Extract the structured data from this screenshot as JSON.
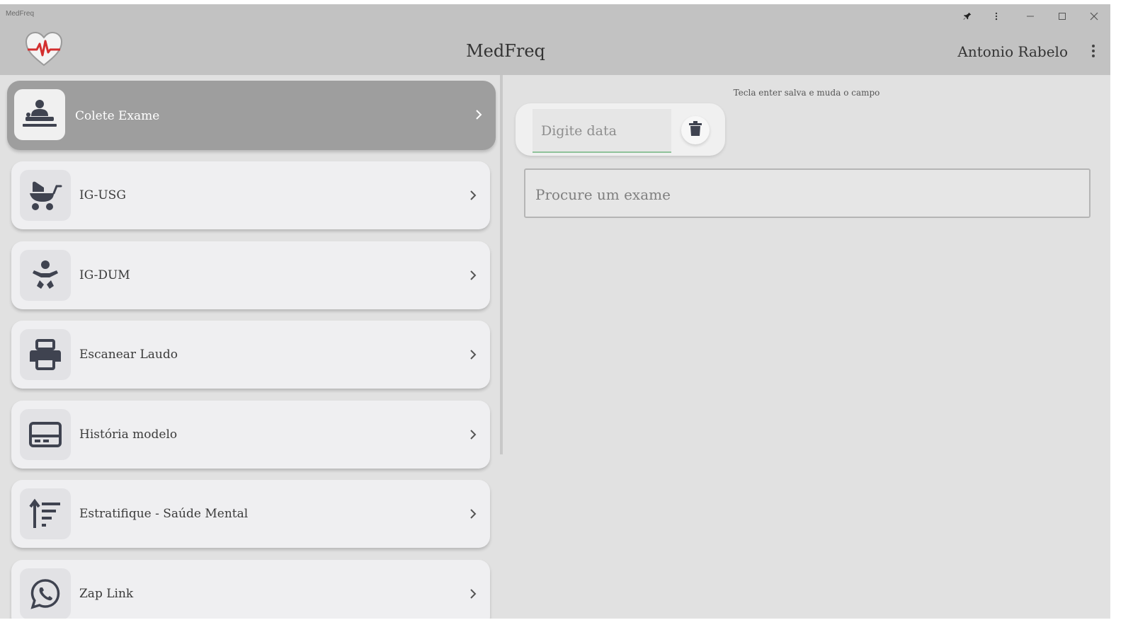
{
  "window": {
    "title": "MedFreq",
    "controls": [
      "pin-icon",
      "more-vert-icon",
      "minimize-icon",
      "maximize-icon",
      "close-icon"
    ]
  },
  "header": {
    "app_title": "MedFreq",
    "user_name": "Antonio Rabelo",
    "logo_icon": "heart-ecg-icon",
    "menu_icon": "more-vert-icon"
  },
  "sidebar": {
    "items": [
      {
        "label": "Colete Exame",
        "icon": "doctor-patient-icon",
        "active": true
      },
      {
        "label": "IG-USG",
        "icon": "baby-stroller-icon",
        "active": false
      },
      {
        "label": "IG-DUM",
        "icon": "baby-icon",
        "active": false
      },
      {
        "label": "Escanear Laudo",
        "icon": "printer-icon",
        "active": false
      },
      {
        "label": "História modelo",
        "icon": "card-template-icon",
        "active": false
      },
      {
        "label": "Estratifique - Saúde Mental",
        "icon": "sort-filter-icon",
        "active": false
      },
      {
        "label": "Zap Link",
        "icon": "whatsapp-icon",
        "active": false
      }
    ]
  },
  "content": {
    "hint": "Tecla enter salva e muda o campo",
    "date": {
      "value": "",
      "placeholder": "Digite data",
      "clear_icon": "trash-icon"
    },
    "search": {
      "value": "",
      "placeholder": "Procure um exame"
    }
  },
  "colors": {
    "header_bg": "#c2c2c2",
    "content_bg": "#e1e1e1",
    "active_card_bg": "#9e9e9e",
    "card_bg": "#efeff1",
    "icon_color": "#3f4350",
    "logo_red": "#d32f2f",
    "field_underline": "#8fc29a"
  }
}
